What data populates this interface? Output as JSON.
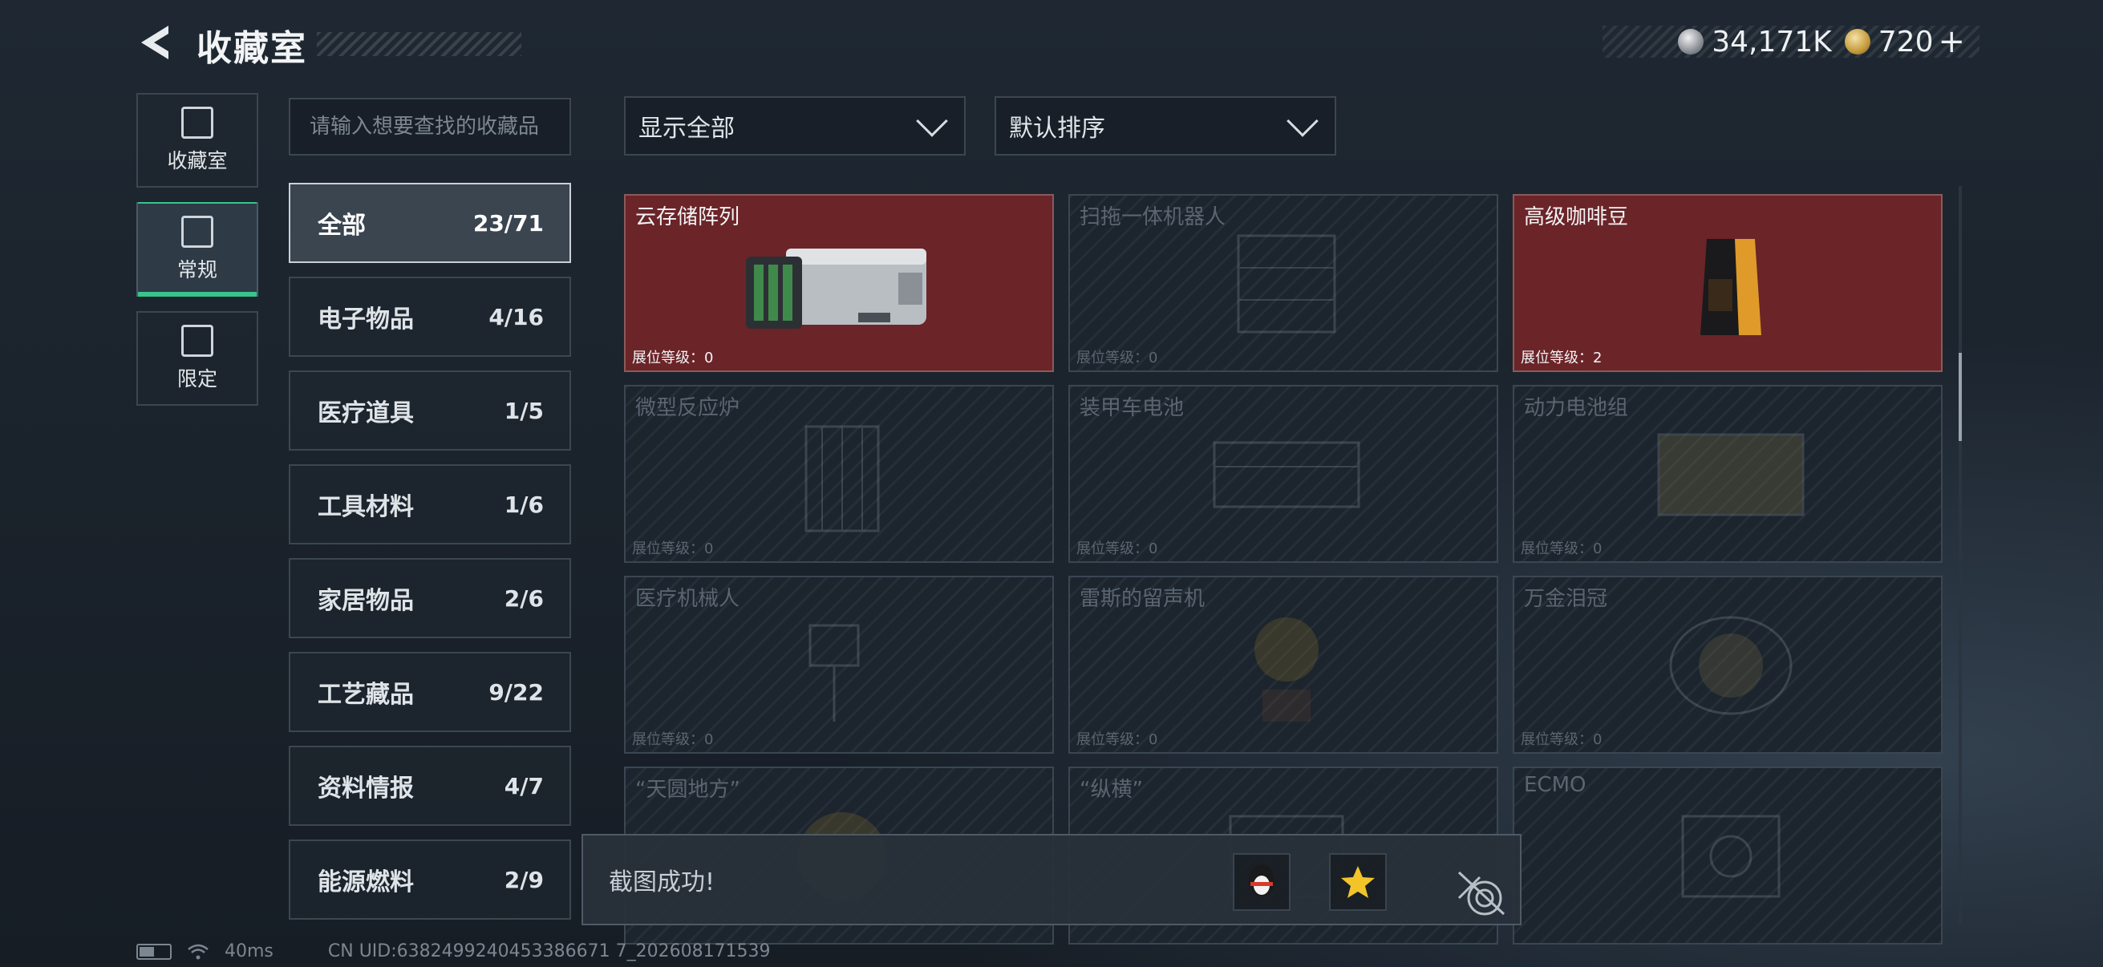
{
  "header": {
    "title": "收藏室",
    "currency": [
      {
        "amount": "34,171K",
        "icon": "silver-coin-icon"
      },
      {
        "amount": "720",
        "icon": "gold-coin-icon"
      }
    ],
    "plus": "+"
  },
  "rail": [
    {
      "label": "收藏室",
      "icon": "collection-box-icon"
    },
    {
      "label": "常规",
      "icon": "display-frame-icon"
    },
    {
      "label": "限定",
      "icon": "limited-icon"
    }
  ],
  "search": {
    "placeholder": "请输入想要查找的收藏品"
  },
  "filters": {
    "show": "显示全部",
    "sort": "默认排序"
  },
  "categories": [
    {
      "name": "全部",
      "count": "23/71"
    },
    {
      "name": "电子物品",
      "count": "4/16"
    },
    {
      "name": "医疗道具",
      "count": "1/5"
    },
    {
      "name": "工具材料",
      "count": "1/6"
    },
    {
      "name": "家居物品",
      "count": "2/6"
    },
    {
      "name": "工艺藏品",
      "count": "9/22"
    },
    {
      "name": "资料情报",
      "count": "4/7"
    },
    {
      "name": "能源燃料",
      "count": "2/9"
    }
  ],
  "items": [
    {
      "name": "云存储阵列",
      "level": "展位等级：0",
      "owned": true
    },
    {
      "name": "扫拖一体机器人",
      "level": "展位等级：0",
      "owned": false
    },
    {
      "name": "高级咖啡豆",
      "level": "展位等级：2",
      "owned": true
    },
    {
      "name": "微型反应炉",
      "level": "展位等级：0",
      "owned": false
    },
    {
      "name": "装甲车电池",
      "level": "展位等级：0",
      "owned": false
    },
    {
      "name": "动力电池组",
      "level": "展位等级：0",
      "owned": false
    },
    {
      "name": "医疗机械人",
      "level": "展位等级：0",
      "owned": false
    },
    {
      "name": "雷斯的留声机",
      "level": "展位等级：0",
      "owned": false
    },
    {
      "name": "万金泪冠",
      "level": "展位等级：0",
      "owned": false
    },
    {
      "name": "“天圆地方”",
      "level": "",
      "owned": false
    },
    {
      "name": "“纵横”",
      "level": "",
      "owned": false
    },
    {
      "name": "ECMO",
      "level": "",
      "owned": false
    }
  ],
  "toast": {
    "text": "截图成功!"
  },
  "footer": {
    "ping": "40ms",
    "uid": "CN UID:6382499240453386671 7_202608171539"
  },
  "colors": {
    "accent": "#38c48a",
    "owned_bg": "#6b2428"
  }
}
